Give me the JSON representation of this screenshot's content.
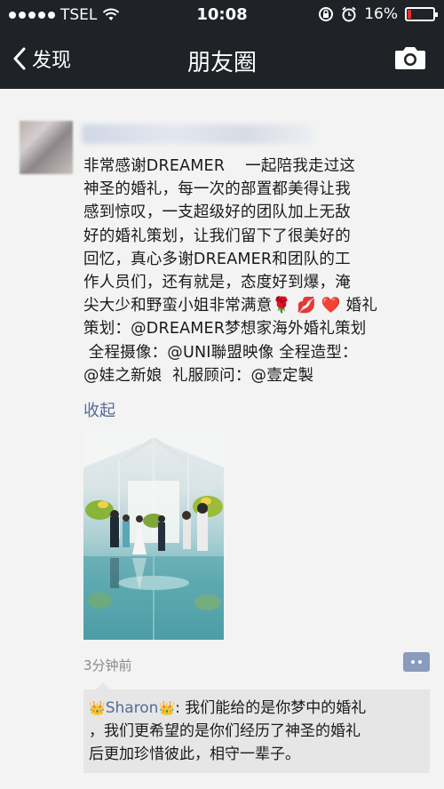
{
  "status_bar": {
    "carrier": "TSEL",
    "time": "10:08",
    "battery_percent": "16%",
    "battery_level": 0.16,
    "signal_icon": "signal-dots-icon",
    "wifi_icon": "wifi-icon",
    "lock_icon": "rotation-lock-icon",
    "alarm_icon": "alarm-icon"
  },
  "nav": {
    "back_label": "发现",
    "title": "朋友圈",
    "camera_icon": "camera-icon"
  },
  "post": {
    "text": "非常感谢DREAMER    一起陪我走过这\n神圣的婚礼，每一次的部置都美得让我\n感到惊叹，一支超级好的团队加上无敌\n好的婚礼策划，让我们留下了很美好的\n回忆，真心多谢DREAMER和团队的工\n作人员们，还有就是，态度好到爆，淹\n尖大少和野蛮小姐非常满意🌹 💋 ❤️ 婚礼\n策划：@DREAMER梦想家海外婚礼策划\n 全程摄像：@UNI聯盟映像 全程造型：\n@娃之新娘  礼服顾问：@壹定製",
    "collapse_label": "收起",
    "timestamp": "3分钟前",
    "comment_button_icon": "comment-more-icon"
  },
  "comments": [
    {
      "prefix_icon": "👑",
      "name": "Sharon",
      "suffix_icon": "👑",
      "text": ": 我们能给的是你梦中的婚礼\n，我们更希望的是你们经历了神圣的婚礼\n后更加珍惜彼此，相守一辈子。"
    }
  ],
  "colors": {
    "bar_bg": "#1f2226",
    "link_blue": "#576b95",
    "battery_low": "#e0312b"
  }
}
